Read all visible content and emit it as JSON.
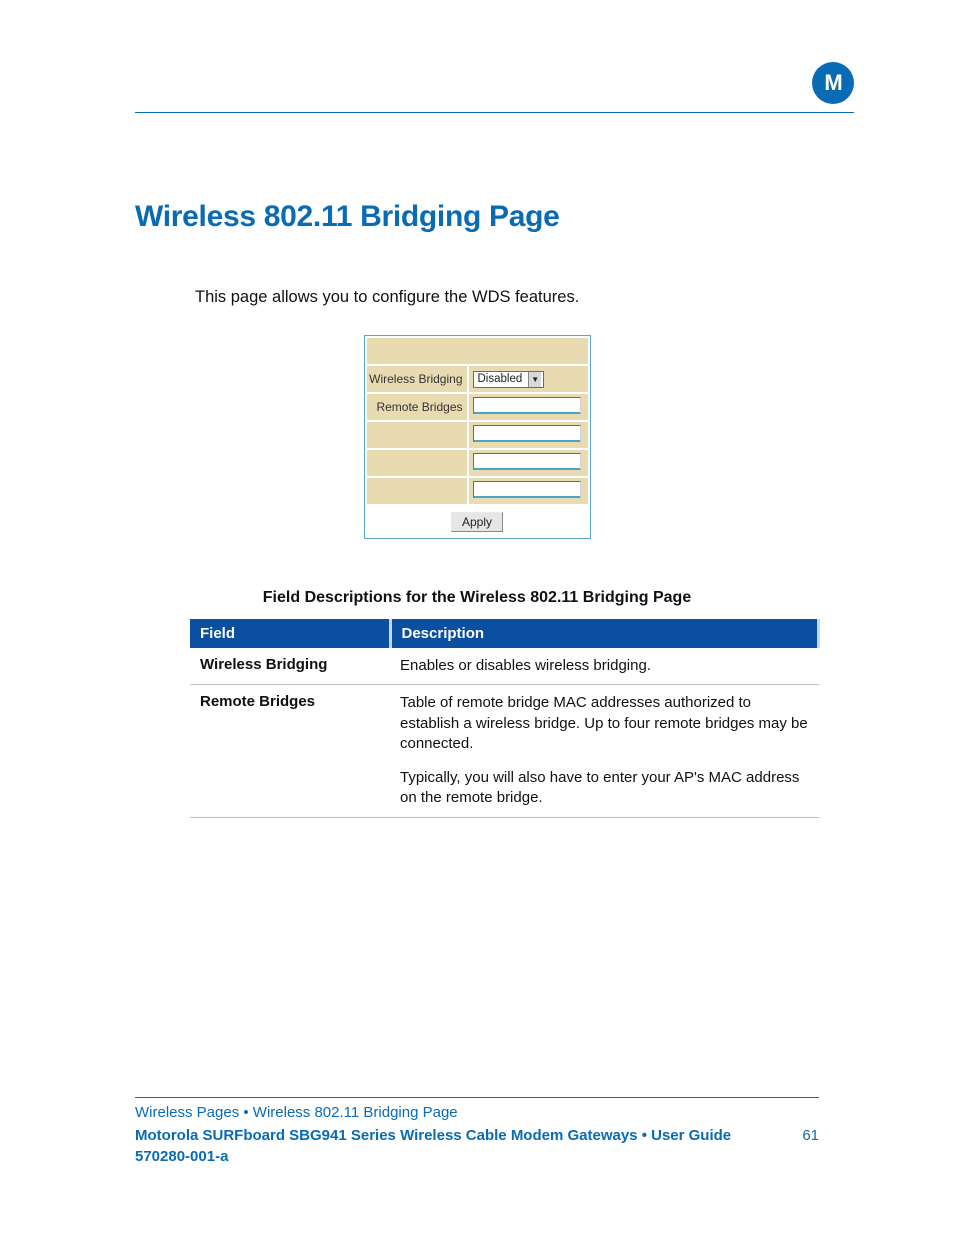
{
  "logo_letter": "M",
  "title": "Wireless 802.11 Bridging Page",
  "intro": "This page allows you to configure the WDS features.",
  "config": {
    "row1_label": "Wireless Bridging",
    "row1_value": "Disabled",
    "row2_label": "Remote Bridges",
    "apply_label": "Apply"
  },
  "desc_title": "Field Descriptions for the Wireless 802.11 Bridging Page",
  "field_header": {
    "col1": "Field",
    "col2": "Description"
  },
  "fields": [
    {
      "name": "Wireless Bridging",
      "desc1": "Enables or disables wireless bridging.",
      "desc2": ""
    },
    {
      "name": "Remote Bridges",
      "desc1": "Table of remote bridge MAC addresses authorized to establish a wireless bridge. Up to four remote bridges may be connected.",
      "desc2": "Typically, you will also have to enter your AP's MAC address on the remote bridge."
    }
  ],
  "footer": {
    "crumb": "Wireless Pages • Wireless 802.11 Bridging Page",
    "pub": "Motorola SURFboard SBG941 Series Wireless Cable Modem Gateways • User Guide",
    "pagenum": "61",
    "docnum": "570280-001-a"
  }
}
